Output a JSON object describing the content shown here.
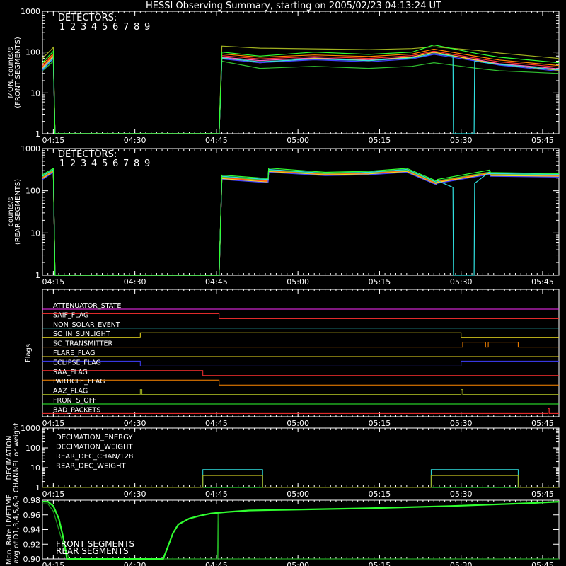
{
  "title": "HESSI Observing Summary, starting on 2005/02/23 04:13:24 UT",
  "x_axis": {
    "min_min": 0,
    "max_min": 95,
    "tick_labels": [
      "04:15",
      "04:30",
      "04:45",
      "05:00",
      "05:15",
      "05:30",
      "05:45"
    ],
    "tick_minutes": [
      2,
      17,
      32,
      47,
      62,
      77,
      92
    ]
  },
  "detectors": {
    "label": "DETECTORS:",
    "numbers": [
      "1",
      "2",
      "3",
      "4",
      "5",
      "6",
      "7",
      "8",
      "9"
    ],
    "colors": [
      "#ff3030",
      "#ff60c0",
      "#ff8800",
      "#f0e020",
      "#a0b020",
      "#30c030",
      "#30ff30",
      "#30e0e0",
      "#4040ff"
    ]
  },
  "chart_data": [
    {
      "type": "line",
      "id": "front",
      "ylabel": [
        "MON. counts/s",
        "(FRONT SEGMENTS)"
      ],
      "yscale": "log",
      "ylim": [
        1,
        1000
      ],
      "ytick_labels": [
        "1",
        "10",
        "100",
        "1000"
      ],
      "x_unit": "minutes after 04:13:24 UT",
      "series": [
        {
          "color": "#ff3030",
          "x": [
            0,
            2,
            2.3,
            32.5,
            33,
            40,
            50,
            60,
            68,
            72,
            80,
            84,
            95
          ],
          "y": [
            45,
            85,
            1,
            1,
            82,
            68,
            78,
            70,
            82,
            105,
            70,
            58,
            43
          ]
        },
        {
          "color": "#ff60c0",
          "x": [
            0,
            2,
            2.3,
            32.5,
            33,
            40,
            50,
            60,
            68,
            72,
            80,
            84,
            95
          ],
          "y": [
            40,
            78,
            1,
            1,
            75,
            62,
            72,
            64,
            76,
            98,
            65,
            52,
            39
          ]
        },
        {
          "color": "#ff8800",
          "x": [
            0,
            2,
            2.3,
            32.5,
            33,
            40,
            50,
            60,
            68,
            72,
            80,
            84,
            95
          ],
          "y": [
            50,
            92,
            1,
            1,
            90,
            75,
            85,
            78,
            90,
            118,
            78,
            64,
            47
          ]
        },
        {
          "color": "#f0e020",
          "x": [
            0,
            2,
            2.3,
            32.5,
            33,
            40,
            50,
            60,
            68,
            72,
            80,
            84,
            95
          ],
          "y": [
            42,
            80,
            1,
            1,
            70,
            55,
            70,
            62,
            75,
            100,
            62,
            50,
            36
          ]
        },
        {
          "color": "#a0b020",
          "x": [
            0,
            2,
            2.3,
            32.5,
            33,
            40,
            50,
            60,
            68,
            72,
            80,
            84,
            95
          ],
          "y": [
            70,
            130,
            1,
            1,
            140,
            125,
            120,
            115,
            122,
            135,
            110,
            95,
            70
          ]
        },
        {
          "color": "#30c030",
          "x": [
            0,
            2,
            2.3,
            32.5,
            33,
            40,
            50,
            60,
            68,
            72,
            80,
            84,
            95
          ],
          "y": [
            35,
            60,
            1,
            1,
            60,
            40,
            45,
            40,
            45,
            55,
            40,
            35,
            30
          ]
        },
        {
          "color": "#30ff30",
          "x": [
            0,
            2,
            2.3,
            32.5,
            33,
            40,
            50,
            60,
            68,
            72,
            80,
            84,
            95
          ],
          "y": [
            55,
            105,
            1,
            1,
            100,
            80,
            100,
            88,
            100,
            150,
            92,
            75,
            55
          ]
        },
        {
          "color": "#30e0e0",
          "x": [
            0,
            2,
            2.3,
            32.5,
            33,
            40,
            50,
            60,
            68,
            72,
            75.5,
            75.6,
            79.4,
            79.5,
            84,
            95
          ],
          "y": [
            38,
            72,
            1,
            1,
            72,
            58,
            68,
            62,
            72,
            92,
            80,
            1,
            1,
            60,
            50,
            37
          ]
        },
        {
          "color": "#4040ff",
          "x": [
            0,
            2,
            2.3,
            32.5,
            33,
            40,
            50,
            60,
            68,
            72,
            80,
            84,
            95
          ],
          "y": [
            36,
            70,
            1,
            1,
            68,
            55,
            65,
            58,
            68,
            88,
            60,
            48,
            34
          ]
        }
      ]
    },
    {
      "type": "line",
      "id": "rear",
      "ylabel": [
        "counts/s",
        "(REAR SEGMENTS)"
      ],
      "yscale": "log",
      "ylim": [
        1,
        1000
      ],
      "ytick_labels": [
        "1",
        "10",
        "100",
        "1000"
      ],
      "x_unit": "minutes after 04:13:24 UT",
      "series": [
        {
          "color": "#ff3030",
          "x": [
            0,
            2,
            2.3,
            32.5,
            33,
            41.5,
            41.6,
            52,
            60,
            67,
            72.5,
            72.6,
            82.3,
            82.4,
            95
          ],
          "y": [
            200,
            290,
            1,
            1,
            200,
            165,
            290,
            240,
            255,
            290,
            145,
            160,
            260,
            235,
            225
          ]
        },
        {
          "color": "#ff60c0",
          "x": [
            0,
            2,
            2.3,
            32.5,
            33,
            41.5,
            41.6,
            52,
            60,
            67,
            72.5,
            72.6,
            82.3,
            82.4,
            95
          ],
          "y": [
            190,
            280,
            1,
            1,
            190,
            160,
            280,
            235,
            245,
            280,
            140,
            155,
            250,
            225,
            215
          ]
        },
        {
          "color": "#ff8800",
          "x": [
            0,
            2,
            2.3,
            32.5,
            33,
            41.5,
            41.6,
            52,
            60,
            67,
            72.5,
            72.6,
            82.3,
            82.4,
            95
          ],
          "y": [
            205,
            300,
            1,
            1,
            205,
            170,
            295,
            245,
            260,
            295,
            150,
            165,
            265,
            240,
            230
          ]
        },
        {
          "color": "#f0e020",
          "x": [
            0,
            2,
            2.3,
            32.5,
            33,
            41.5,
            41.6,
            52,
            60,
            67,
            72.5,
            72.6,
            82.3,
            82.4,
            95
          ],
          "y": [
            195,
            285,
            1,
            1,
            195,
            160,
            285,
            238,
            250,
            285,
            142,
            158,
            255,
            230,
            220
          ]
        },
        {
          "color": "#a0b020",
          "x": [
            0,
            2,
            2.3,
            32.5,
            33,
            41.5,
            41.6,
            52,
            60,
            67,
            72.5,
            72.6,
            82.3,
            82.4,
            95
          ],
          "y": [
            210,
            305,
            1,
            1,
            210,
            175,
            305,
            250,
            265,
            305,
            155,
            170,
            275,
            245,
            235
          ]
        },
        {
          "color": "#30c030",
          "x": [
            0,
            2,
            2.3,
            32.5,
            33,
            41.5,
            41.6,
            52,
            60,
            67,
            72.5,
            72.6,
            82.3,
            82.4,
            95
          ],
          "y": [
            215,
            310,
            1,
            1,
            215,
            178,
            310,
            255,
            270,
            310,
            158,
            172,
            280,
            250,
            240
          ]
        },
        {
          "color": "#30ff30",
          "x": [
            0,
            2,
            2.3,
            32.5,
            33,
            41.5,
            41.6,
            52,
            60,
            67,
            72.5,
            72.6,
            82.3,
            82.4,
            95
          ],
          "y": [
            240,
            340,
            1,
            1,
            235,
            195,
            345,
            275,
            290,
            340,
            170,
            185,
            310,
            270,
            255
          ]
        },
        {
          "color": "#30e0e0",
          "x": [
            0,
            2,
            2.3,
            32.5,
            33,
            41.5,
            41.6,
            52,
            60,
            67,
            72.5,
            72.6,
            75.5,
            75.6,
            79.4,
            79.5,
            82.3,
            82.4,
            95
          ],
          "y": [
            225,
            320,
            1,
            1,
            220,
            185,
            320,
            260,
            275,
            320,
            160,
            175,
            120,
            1,
            1,
            150,
            285,
            255,
            245
          ]
        },
        {
          "color": "#4040ff",
          "x": [
            0,
            2,
            2.3,
            32.5,
            33,
            41.5,
            41.6,
            52,
            60,
            67,
            72.5,
            72.6,
            82.3,
            82.4,
            95
          ],
          "y": [
            185,
            275,
            1,
            1,
            185,
            155,
            275,
            230,
            240,
            275,
            138,
            150,
            245,
            220,
            210
          ]
        }
      ]
    },
    {
      "type": "line",
      "id": "flags",
      "ylabel": "Flags",
      "x_unit": "minutes after 04:13:24 UT",
      "series": [
        {
          "name": "ATTENUATOR_STATE",
          "color": "#ff30ff",
          "x": [
            0,
            95
          ],
          "y": [
            0,
            0
          ]
        },
        {
          "name": "SAIF_FLAG",
          "color": "#ff3030",
          "x": [
            0,
            32.5,
            32.5,
            95
          ],
          "y": [
            1,
            1,
            0,
            0
          ]
        },
        {
          "name": "NON_SOLAR_EVENT",
          "color": "#30e0e0",
          "x": [
            0,
            95
          ],
          "y": [
            0,
            0
          ]
        },
        {
          "name": "SC_IN_SUNLIGHT",
          "color": "#f0e020",
          "x": [
            0,
            18,
            18,
            77,
            77,
            95
          ],
          "y": [
            0,
            0,
            1,
            1,
            0,
            0
          ]
        },
        {
          "name": "SC_TRANSMITTER",
          "color": "#ff8800",
          "x": [
            0,
            77.3,
            77.3,
            81.5,
            81.5,
            82,
            82,
            87.5,
            87.5,
            95
          ],
          "y": [
            0,
            0,
            1,
            1,
            0,
            0,
            1,
            1,
            0,
            0
          ]
        },
        {
          "name": "FLARE_FLAG",
          "color": "#f0e020",
          "x": [
            0,
            95
          ],
          "y": [
            0,
            0
          ]
        },
        {
          "name": "ECLIPSE_FLAG",
          "color": "#4040ff",
          "x": [
            0,
            18,
            18,
            77,
            77,
            95
          ],
          "y": [
            1,
            1,
            0,
            0,
            1,
            1
          ]
        },
        {
          "name": "SAA_FLAG",
          "color": "#ff3030",
          "x": [
            0,
            29.5,
            29.5,
            95
          ],
          "y": [
            1,
            1,
            0,
            0
          ]
        },
        {
          "name": "PARTICLE_FLAG",
          "color": "#ff8800",
          "x": [
            0,
            32.5,
            32.5,
            95
          ],
          "y": [
            1,
            1,
            0,
            0
          ]
        },
        {
          "name": "AAZ_FLAG",
          "color": "#a0b020",
          "x": [
            0,
            18,
            18,
            18.3,
            18.3,
            77,
            77,
            77.3,
            77.3,
            95
          ],
          "y": [
            0,
            0,
            1,
            1,
            0,
            0,
            1,
            1,
            0,
            0
          ]
        },
        {
          "name": "FRONTS_OFF",
          "color": "#30ff30",
          "x": [
            0,
            95
          ],
          "y": [
            0,
            0
          ]
        },
        {
          "name": "BAD_PACKETS",
          "color": "#ff3030",
          "x": [
            0,
            93,
            93,
            93.2,
            93.2,
            95
          ],
          "y": [
            0,
            0,
            1,
            1,
            0,
            0
          ]
        }
      ]
    },
    {
      "type": "line",
      "id": "decimation",
      "ylabel": [
        "DECIMATION",
        "CHANNEL or weight"
      ],
      "yscale": "log",
      "ylim": [
        1,
        1000
      ],
      "ytick_labels": [
        "1",
        "10",
        "100",
        "1000"
      ],
      "x_unit": "minutes after 04:13:24 UT",
      "series": [
        {
          "name": "DECIMATION_ENERGY",
          "color": "#30ff30",
          "x": [
            0,
            95
          ],
          "y": [
            1,
            1
          ]
        },
        {
          "name": "DECIMATION_WEIGHT",
          "color": "#ff8800",
          "x": [
            0,
            29.5,
            29.5,
            40.5,
            40.5,
            71.5,
            71.5,
            87.5,
            87.5,
            95
          ],
          "y": [
            1,
            1,
            4,
            4,
            1,
            1,
            4,
            4,
            1,
            1
          ]
        },
        {
          "name": "REAR_DEC_CHAN/128",
          "color": "#30e0e0",
          "x": [
            0,
            29.5,
            29.5,
            40.5,
            40.5,
            71.5,
            71.5,
            87.5,
            87.5,
            95
          ],
          "y": [
            1,
            1,
            8,
            8,
            1,
            1,
            8,
            8,
            1,
            1
          ]
        },
        {
          "name": "REAR_DEC_WEIGHT",
          "color": "#a0b020",
          "x": [
            0,
            29.5,
            29.5,
            40.5,
            40.5,
            71.5,
            71.5,
            87.5,
            87.5,
            95
          ],
          "y": [
            1,
            1,
            4,
            4,
            1,
            1,
            4,
            4,
            1,
            1
          ]
        }
      ]
    },
    {
      "type": "line",
      "id": "livetime",
      "ylabel": [
        "Mon. Rate LIVETIME",
        "avg of D1,3,4,5,6,9"
      ],
      "ylim": [
        0.9,
        0.98
      ],
      "ytick_labels": [
        "0.90",
        "0.92",
        "0.94",
        "0.96",
        "0.98"
      ],
      "x_unit": "minutes after 04:13:24 UT",
      "series": [
        {
          "name": "FRONT SEGMENTS",
          "color": "#30ff30",
          "x": [
            0,
            1,
            2,
            3,
            3.8,
            4.3,
            4.5,
            22.2,
            23,
            24,
            25,
            27,
            29,
            31,
            34,
            38,
            45,
            60,
            75,
            90,
            95
          ],
          "y": [
            0.978,
            0.978,
            0.972,
            0.955,
            0.93,
            0.91,
            0.9,
            0.9,
            0.915,
            0.935,
            0.947,
            0.955,
            0.959,
            0.962,
            0.964,
            0.966,
            0.967,
            0.969,
            0.972,
            0.976,
            0.978
          ]
        },
        {
          "name": "REAR SEGMENTS",
          "color": "#20a020",
          "x": [
            0,
            1,
            2,
            3,
            4,
            5,
            32.2,
            32.3,
            32.4,
            95
          ],
          "y": [
            0.975,
            0.975,
            0.965,
            0.94,
            0.915,
            0.9,
            0.9,
            0.962,
            0.9,
            0.9
          ]
        }
      ]
    }
  ]
}
